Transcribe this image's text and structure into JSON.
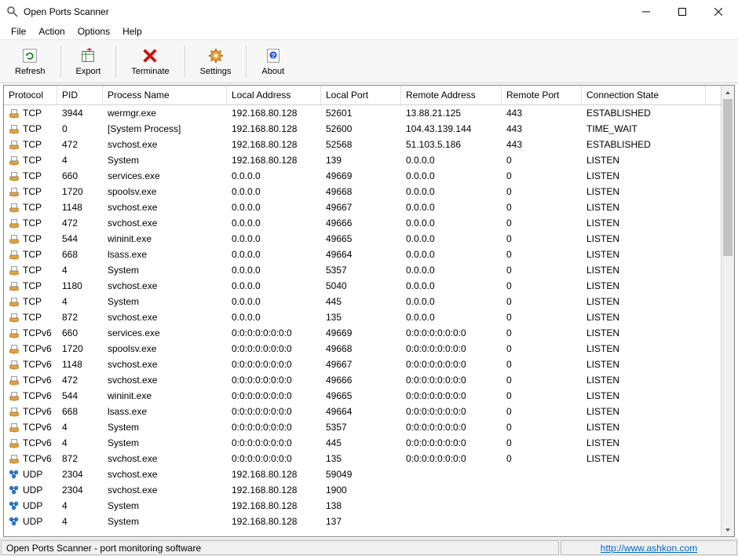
{
  "window": {
    "title": "Open Ports Scanner",
    "minimize": "—",
    "maximize": "☐",
    "close": "✕"
  },
  "menu": {
    "file": "File",
    "action": "Action",
    "options": "Options",
    "help": "Help"
  },
  "toolbar": {
    "refresh": "Refresh",
    "export": "Export",
    "terminate": "Terminate",
    "settings": "Settings",
    "about": "About"
  },
  "columns": {
    "protocol": "Protocol",
    "pid": "PID",
    "process": "Process Name",
    "local_addr": "Local Address",
    "local_port": "Local Port",
    "remote_addr": "Remote Address",
    "remote_port": "Remote Port",
    "state": "Connection State"
  },
  "rows": [
    {
      "protocol": "TCP",
      "pid": "3944",
      "process": "wermgr.exe",
      "local_addr": "192.168.80.128",
      "local_port": "52601",
      "remote_addr": "13.88.21.125",
      "remote_port": "443",
      "state": "ESTABLISHED"
    },
    {
      "protocol": "TCP",
      "pid": "0",
      "process": "[System Process]",
      "local_addr": "192.168.80.128",
      "local_port": "52600",
      "remote_addr": "104.43.139.144",
      "remote_port": "443",
      "state": "TIME_WAIT"
    },
    {
      "protocol": "TCP",
      "pid": "472",
      "process": "svchost.exe",
      "local_addr": "192.168.80.128",
      "local_port": "52568",
      "remote_addr": "51.103.5.186",
      "remote_port": "443",
      "state": "ESTABLISHED"
    },
    {
      "protocol": "TCP",
      "pid": "4",
      "process": "System",
      "local_addr": "192.168.80.128",
      "local_port": "139",
      "remote_addr": "0.0.0.0",
      "remote_port": "0",
      "state": "LISTEN"
    },
    {
      "protocol": "TCP",
      "pid": "660",
      "process": "services.exe",
      "local_addr": "0.0.0.0",
      "local_port": "49669",
      "remote_addr": "0.0.0.0",
      "remote_port": "0",
      "state": "LISTEN"
    },
    {
      "protocol": "TCP",
      "pid": "1720",
      "process": "spoolsv.exe",
      "local_addr": "0.0.0.0",
      "local_port": "49668",
      "remote_addr": "0.0.0.0",
      "remote_port": "0",
      "state": "LISTEN"
    },
    {
      "protocol": "TCP",
      "pid": "1148",
      "process": "svchost.exe",
      "local_addr": "0.0.0.0",
      "local_port": "49667",
      "remote_addr": "0.0.0.0",
      "remote_port": "0",
      "state": "LISTEN"
    },
    {
      "protocol": "TCP",
      "pid": "472",
      "process": "svchost.exe",
      "local_addr": "0.0.0.0",
      "local_port": "49666",
      "remote_addr": "0.0.0.0",
      "remote_port": "0",
      "state": "LISTEN"
    },
    {
      "protocol": "TCP",
      "pid": "544",
      "process": "wininit.exe",
      "local_addr": "0.0.0.0",
      "local_port": "49665",
      "remote_addr": "0.0.0.0",
      "remote_port": "0",
      "state": "LISTEN"
    },
    {
      "protocol": "TCP",
      "pid": "668",
      "process": "lsass.exe",
      "local_addr": "0.0.0.0",
      "local_port": "49664",
      "remote_addr": "0.0.0.0",
      "remote_port": "0",
      "state": "LISTEN"
    },
    {
      "protocol": "TCP",
      "pid": "4",
      "process": "System",
      "local_addr": "0.0.0.0",
      "local_port": "5357",
      "remote_addr": "0.0.0.0",
      "remote_port": "0",
      "state": "LISTEN"
    },
    {
      "protocol": "TCP",
      "pid": "1180",
      "process": "svchost.exe",
      "local_addr": "0.0.0.0",
      "local_port": "5040",
      "remote_addr": "0.0.0.0",
      "remote_port": "0",
      "state": "LISTEN"
    },
    {
      "protocol": "TCP",
      "pid": "4",
      "process": "System",
      "local_addr": "0.0.0.0",
      "local_port": "445",
      "remote_addr": "0.0.0.0",
      "remote_port": "0",
      "state": "LISTEN"
    },
    {
      "protocol": "TCP",
      "pid": "872",
      "process": "svchost.exe",
      "local_addr": "0.0.0.0",
      "local_port": "135",
      "remote_addr": "0.0.0.0",
      "remote_port": "0",
      "state": "LISTEN"
    },
    {
      "protocol": "TCPv6",
      "pid": "660",
      "process": "services.exe",
      "local_addr": "0:0:0:0:0:0:0:0",
      "local_port": "49669",
      "remote_addr": "0:0:0:0:0:0:0:0",
      "remote_port": "0",
      "state": "LISTEN"
    },
    {
      "protocol": "TCPv6",
      "pid": "1720",
      "process": "spoolsv.exe",
      "local_addr": "0:0:0:0:0:0:0:0",
      "local_port": "49668",
      "remote_addr": "0:0:0:0:0:0:0:0",
      "remote_port": "0",
      "state": "LISTEN"
    },
    {
      "protocol": "TCPv6",
      "pid": "1148",
      "process": "svchost.exe",
      "local_addr": "0:0:0:0:0:0:0:0",
      "local_port": "49667",
      "remote_addr": "0:0:0:0:0:0:0:0",
      "remote_port": "0",
      "state": "LISTEN"
    },
    {
      "protocol": "TCPv6",
      "pid": "472",
      "process": "svchost.exe",
      "local_addr": "0:0:0:0:0:0:0:0",
      "local_port": "49666",
      "remote_addr": "0:0:0:0:0:0:0:0",
      "remote_port": "0",
      "state": "LISTEN"
    },
    {
      "protocol": "TCPv6",
      "pid": "544",
      "process": "wininit.exe",
      "local_addr": "0:0:0:0:0:0:0:0",
      "local_port": "49665",
      "remote_addr": "0:0:0:0:0:0:0:0",
      "remote_port": "0",
      "state": "LISTEN"
    },
    {
      "protocol": "TCPv6",
      "pid": "668",
      "process": "lsass.exe",
      "local_addr": "0:0:0:0:0:0:0:0",
      "local_port": "49664",
      "remote_addr": "0:0:0:0:0:0:0:0",
      "remote_port": "0",
      "state": "LISTEN"
    },
    {
      "protocol": "TCPv6",
      "pid": "4",
      "process": "System",
      "local_addr": "0:0:0:0:0:0:0:0",
      "local_port": "5357",
      "remote_addr": "0:0:0:0:0:0:0:0",
      "remote_port": "0",
      "state": "LISTEN"
    },
    {
      "protocol": "TCPv6",
      "pid": "4",
      "process": "System",
      "local_addr": "0:0:0:0:0:0:0:0",
      "local_port": "445",
      "remote_addr": "0:0:0:0:0:0:0:0",
      "remote_port": "0",
      "state": "LISTEN"
    },
    {
      "protocol": "TCPv6",
      "pid": "872",
      "process": "svchost.exe",
      "local_addr": "0:0:0:0:0:0:0:0",
      "local_port": "135",
      "remote_addr": "0:0:0:0:0:0:0:0",
      "remote_port": "0",
      "state": "LISTEN"
    },
    {
      "protocol": "UDP",
      "pid": "2304",
      "process": "svchost.exe",
      "local_addr": "192.168.80.128",
      "local_port": "59049",
      "remote_addr": "",
      "remote_port": "",
      "state": ""
    },
    {
      "protocol": "UDP",
      "pid": "2304",
      "process": "svchost.exe",
      "local_addr": "192.168.80.128",
      "local_port": "1900",
      "remote_addr": "",
      "remote_port": "",
      "state": ""
    },
    {
      "protocol": "UDP",
      "pid": "4",
      "process": "System",
      "local_addr": "192.168.80.128",
      "local_port": "138",
      "remote_addr": "",
      "remote_port": "",
      "state": ""
    },
    {
      "protocol": "UDP",
      "pid": "4",
      "process": "System",
      "local_addr": "192.168.80.128",
      "local_port": "137",
      "remote_addr": "",
      "remote_port": "",
      "state": ""
    }
  ],
  "statusbar": {
    "left": "Open Ports Scanner - port monitoring software",
    "link": "http://www.ashkon.com"
  },
  "icons": {
    "tcp_color": "#e8a33c",
    "udp_color": "#3c8de8"
  }
}
